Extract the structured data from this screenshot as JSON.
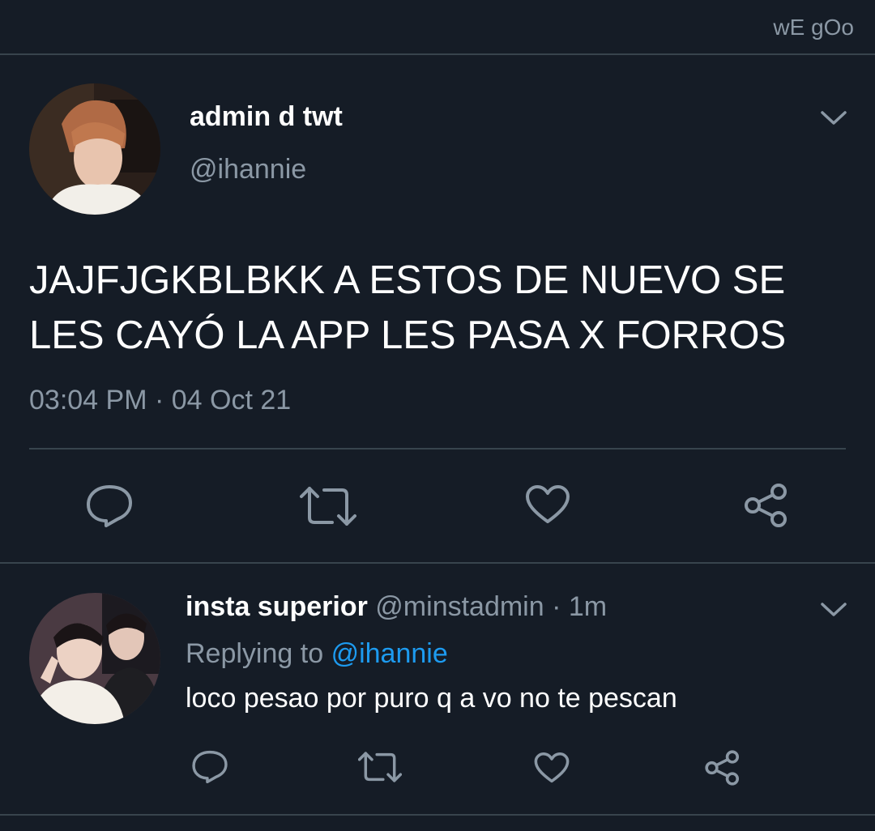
{
  "header": {
    "label": "wE gOo"
  },
  "main_tweet": {
    "display_name": "admin d twt",
    "handle": "@ihannie",
    "text_line1": "JAJFJGKBLBKK A ESTOS DE NUEVO SE",
    "text_line2": "LES CAYÓ LA APP LES PASA X FORROS",
    "time": "03:04 PM",
    "separator": "·",
    "date": "04 Oct 21",
    "actions": [
      "reply-icon",
      "retweet-icon",
      "like-icon",
      "share-icon"
    ]
  },
  "reply_tweet": {
    "display_name": "insta superior",
    "handle": "@minstadmin",
    "separator": "·",
    "age": "1m",
    "replying_prefix": "Replying to",
    "replying_to": "@ihannie",
    "text": "loco pesao por puro q a vo no te pescan",
    "actions": [
      "reply-icon",
      "retweet-icon",
      "like-icon",
      "share-icon"
    ]
  },
  "colors": {
    "background": "#151c26",
    "divider": "#38444d",
    "secondary_text": "#8b98a5",
    "mention": "#1d9bf0"
  }
}
